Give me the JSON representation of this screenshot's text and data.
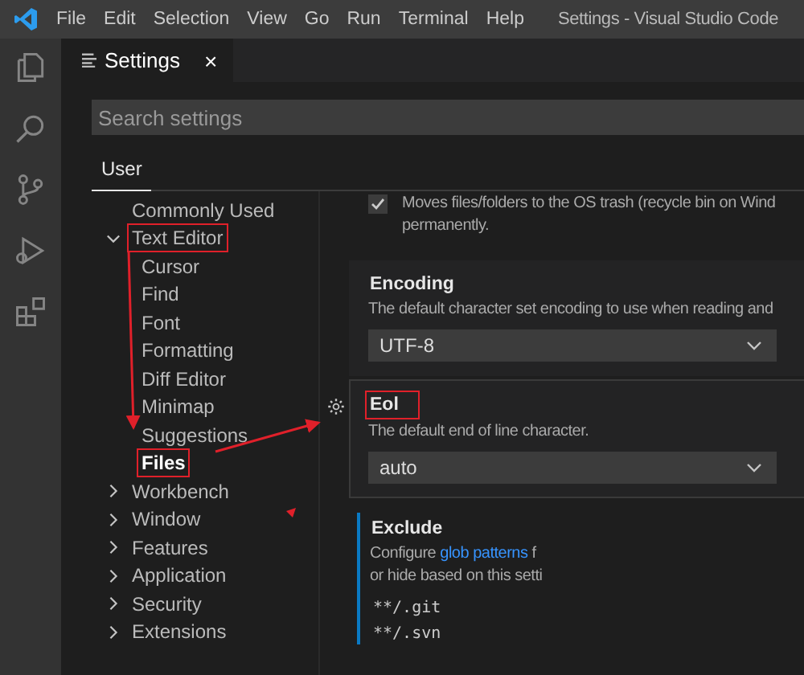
{
  "window": {
    "title": "Settings - Visual Studio Code"
  },
  "menu": [
    "File",
    "Edit",
    "Selection",
    "View",
    "Go",
    "Run",
    "Terminal",
    "Help"
  ],
  "editor_tabs": [
    {
      "label": "Settings",
      "selected": true,
      "close": "×"
    }
  ],
  "search": {
    "placeholder": "Search settings"
  },
  "scope_tabs": [
    {
      "label": "User",
      "selected": true
    }
  ],
  "tree": [
    {
      "label": "Commonly Used",
      "kind": "leaf",
      "selected": false,
      "annotated": false
    },
    {
      "label": "Text Editor",
      "kind": "group",
      "expanded": true,
      "selected": false,
      "annotated": true,
      "children": [
        {
          "label": "Cursor",
          "selected": false,
          "annotated": false
        },
        {
          "label": "Find",
          "selected": false,
          "annotated": false
        },
        {
          "label": "Font",
          "selected": false,
          "annotated": false
        },
        {
          "label": "Formatting",
          "selected": false,
          "annotated": false
        },
        {
          "label": "Diff Editor",
          "selected": false,
          "annotated": false
        },
        {
          "label": "Minimap",
          "selected": false,
          "annotated": false
        },
        {
          "label": "Suggestions",
          "selected": false,
          "annotated": false
        },
        {
          "label": "Files",
          "selected": true,
          "annotated": true
        }
      ]
    },
    {
      "label": "Workbench",
      "kind": "group",
      "expanded": false,
      "selected": false,
      "annotated": false
    },
    {
      "label": "Window",
      "kind": "group",
      "expanded": false,
      "selected": false,
      "annotated": false
    },
    {
      "label": "Features",
      "kind": "group",
      "expanded": false,
      "selected": false,
      "annotated": false
    },
    {
      "label": "Application",
      "kind": "group",
      "expanded": false,
      "selected": false,
      "annotated": false
    },
    {
      "label": "Security",
      "kind": "group",
      "expanded": false,
      "selected": false,
      "annotated": false
    },
    {
      "label": "Extensions",
      "kind": "group",
      "expanded": false,
      "selected": false,
      "annotated": false
    }
  ],
  "settings": [
    {
      "kind": "checkbox",
      "checked": true,
      "lines": [
        "Moves files/folders to the OS trash (recycle bin on Wind",
        "permanently."
      ]
    },
    {
      "kind": "dropdown",
      "title": "Encoding",
      "annotated": false,
      "focused": false,
      "description": "The default character set encoding to use when reading and",
      "value": "UTF-8"
    },
    {
      "kind": "dropdown",
      "title": "Eol",
      "annotated": true,
      "focused": true,
      "description": "The default end of line character.",
      "value": "auto"
    },
    {
      "kind": "list",
      "title": "Exclude",
      "description_lines": [
        {
          "before": "Configure ",
          "link": "glob patterns",
          "after": " f"
        },
        {
          "before": "or hide based on this setti"
        }
      ],
      "items": [
        "**/.git",
        "**/.svn"
      ]
    }
  ]
}
